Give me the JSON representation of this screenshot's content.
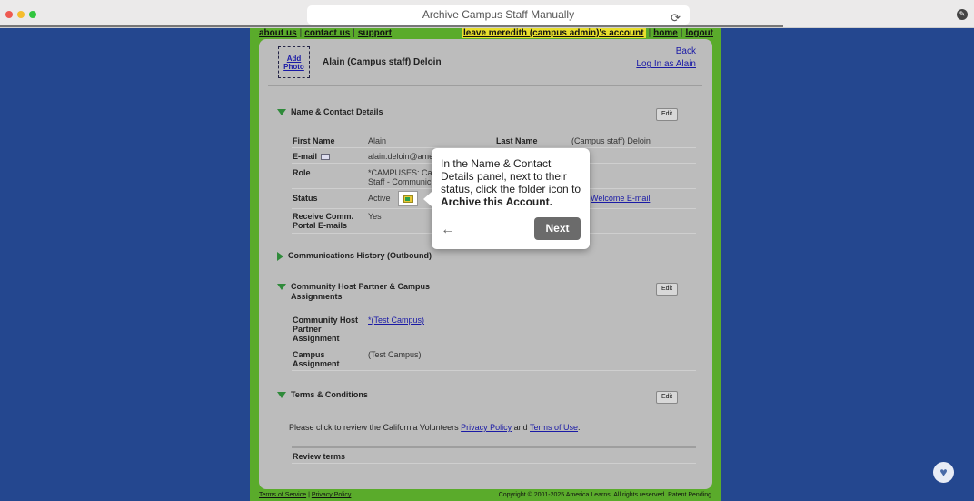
{
  "browser": {
    "url_title": "Archive Campus Staff Manually",
    "reload_icon": "reload-icon"
  },
  "topnav": {
    "about": "about us",
    "contact": "contact us",
    "support": "support",
    "leave": "leave meredith (campus admin)'s account",
    "home": "home",
    "logout": "logout"
  },
  "header": {
    "add_photo_1": "Add",
    "add_photo_2": "Photo",
    "name": "Alain (Campus staff) Deloin",
    "back": "Back",
    "login_as": "Log In as Alain"
  },
  "sections": {
    "contact": "Name & Contact Details",
    "comms": "Communications History (Outbound)",
    "assignments": "Community Host Partner & Campus Assignments",
    "terms": "Terms & Conditions"
  },
  "edit_label": "Edit",
  "contact": {
    "first_name_label": "First Name",
    "first_name": "Alain",
    "last_name_label": "Last Name",
    "last_name": "(Campus staff) Deloin",
    "email_label": "E-mail",
    "email": "alain.deloin@ame",
    "role_label": "Role",
    "role_1": "*CAMPUSES: Ca",
    "role_2": "Staff - Communic",
    "status_label": "Status",
    "status": "Active",
    "welcome_link": "Welcome E-mail",
    "receive_label_1": "Receive Comm.",
    "receive_label_2": "Portal E-mails",
    "receive": "Yes"
  },
  "assignments": {
    "host_label_1": "Community Host",
    "host_label_2": "Partner",
    "host_label_3": "Assignment",
    "host_value": "*(Test Campus)",
    "campus_label_1": "Campus",
    "campus_label_2": "Assignment",
    "campus_value": "(Test Campus)"
  },
  "terms": {
    "text_pre": "Please click to review the California Volunteers",
    "privacy": "Privacy Policy",
    "and": "and",
    "terms_of_use": "Terms of Use",
    "period": ".",
    "review": "Review terms"
  },
  "footer": {
    "tos": "Terms of Service",
    "privacy": "Privacy Policy",
    "copyright": "Copyright © 2001-2025 America Learns. All rights reserved. Patent Pending."
  },
  "tooltip": {
    "text_plain": "In the Name & Contact Details panel, next to their status, click the folder icon to",
    "text_bold": "Archive this Account.",
    "next": "Next"
  }
}
